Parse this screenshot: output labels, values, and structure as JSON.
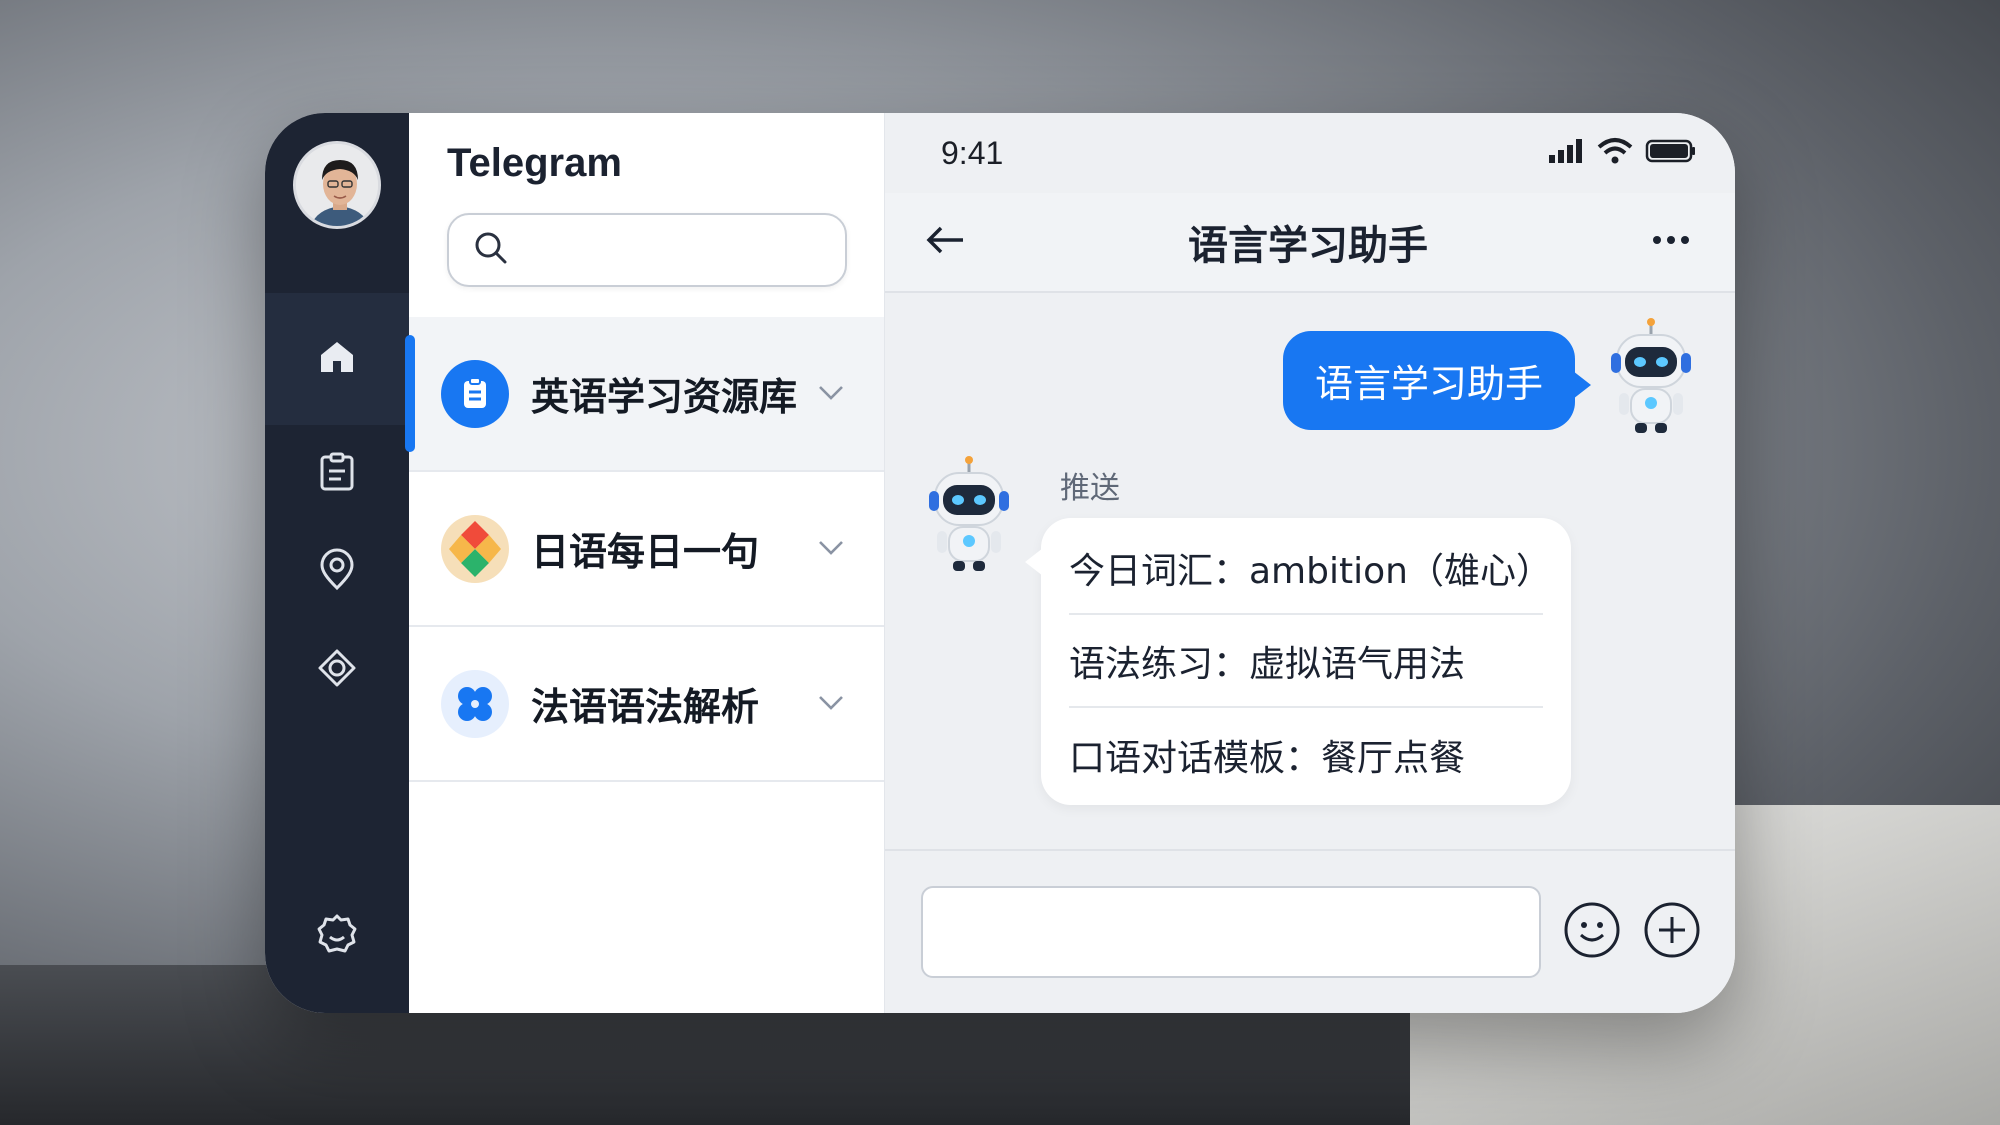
{
  "app": {
    "title": "Telegram"
  },
  "search": {
    "placeholder": ""
  },
  "rail": {
    "items": [
      {
        "icon": "home-icon"
      },
      {
        "icon": "clipboard-icon"
      },
      {
        "icon": "location-pin-icon"
      },
      {
        "icon": "eye-icon"
      }
    ],
    "bottom_icon": "settings-icon"
  },
  "chats": [
    {
      "name": "英语学习资源库",
      "icon": "clipboard-badge-icon",
      "active": true
    },
    {
      "name": "日语每日一句",
      "icon": "diamond-tiles-icon",
      "active": false
    },
    {
      "name": "法语语法解析",
      "icon": "four-dots-icon",
      "active": false
    }
  ],
  "status": {
    "time": "9:41"
  },
  "conversation": {
    "title": "语言学习助手",
    "outgoing_message": "语言学习助手",
    "sender": "推送",
    "push_items": [
      "今日词汇：ambition（雄心）",
      "语法练习：虚拟语气用法",
      "口语对话模板：餐厅点餐"
    ]
  },
  "composer": {
    "placeholder": ""
  },
  "colors": {
    "accent": "#1877f2",
    "rail": "#1d2433"
  }
}
